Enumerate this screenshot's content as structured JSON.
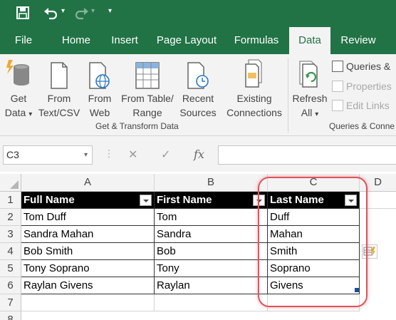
{
  "tabs": [
    "File",
    "Home",
    "Insert",
    "Page Layout",
    "Formulas",
    "Data",
    "Review"
  ],
  "ribbon": {
    "get_data": [
      "Get",
      "Data"
    ],
    "from_text": [
      "From",
      "Text/CSV"
    ],
    "from_web": [
      "From",
      "Web"
    ],
    "from_table": [
      "From Table/",
      "Range"
    ],
    "recent": [
      "Recent",
      "Sources"
    ],
    "existing": [
      "Existing",
      "Connections"
    ],
    "group1_label": "Get & Transform Data",
    "refresh": [
      "Refresh",
      "All"
    ],
    "queries": "Queries &",
    "properties": "Properties",
    "edit_links": "Edit Links",
    "group2_label": "Queries & Conne"
  },
  "formula_bar": {
    "name_box": "C3",
    "fx": "fx"
  },
  "columns": [
    "A",
    "B",
    "C",
    "D"
  ],
  "rows": [
    "1",
    "2",
    "3",
    "4",
    "5",
    "6",
    "7",
    "8"
  ],
  "table": {
    "headers": [
      "Full Name",
      "First Name",
      "Last Name"
    ],
    "data": [
      [
        "Tom Duff",
        "Tom",
        "Duff"
      ],
      [
        "Sandra Mahan",
        "Sandra",
        "Mahan"
      ],
      [
        "Bob Smith",
        "Bob",
        "Smith"
      ],
      [
        "Tony Soprano",
        "Tony",
        "Soprano"
      ],
      [
        "Raylan Givens",
        "Raylan",
        "Givens"
      ]
    ]
  },
  "colors": {
    "accent": "#217346",
    "highlight": "#e0535a"
  }
}
